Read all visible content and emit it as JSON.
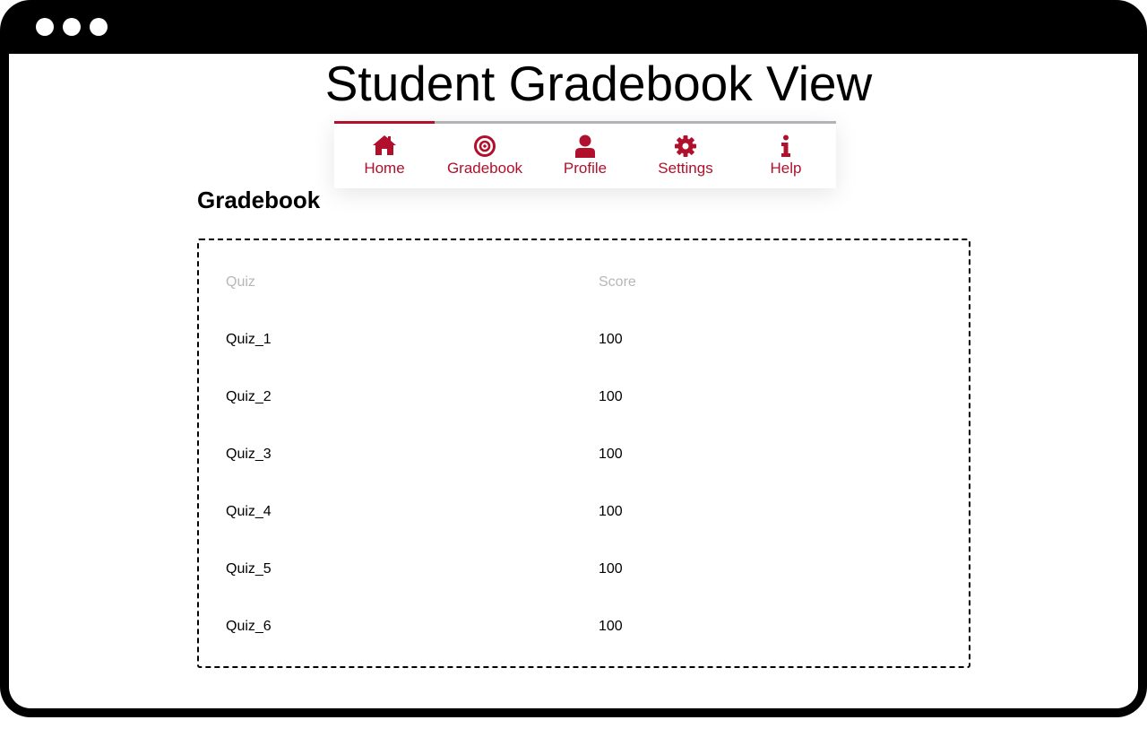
{
  "window": {
    "title": "Student Gradebook View"
  },
  "nav": {
    "active_index": 0,
    "accent_color": "#b0102c",
    "items": [
      {
        "label": "Home",
        "icon": "home-icon"
      },
      {
        "label": "Gradebook",
        "icon": "target-icon"
      },
      {
        "label": "Profile",
        "icon": "user-icon"
      },
      {
        "label": "Settings",
        "icon": "gear-icon"
      },
      {
        "label": "Help",
        "icon": "info-icon"
      }
    ]
  },
  "gradebook": {
    "heading": "Gradebook",
    "columns": [
      "Quiz",
      "Score"
    ],
    "rows": [
      {
        "quiz": "Quiz_1",
        "score": "100"
      },
      {
        "quiz": "Quiz_2",
        "score": "100"
      },
      {
        "quiz": "Quiz_3",
        "score": "100"
      },
      {
        "quiz": "Quiz_4",
        "score": "100"
      },
      {
        "quiz": "Quiz_5",
        "score": "100"
      },
      {
        "quiz": "Quiz_6",
        "score": "100"
      }
    ]
  }
}
